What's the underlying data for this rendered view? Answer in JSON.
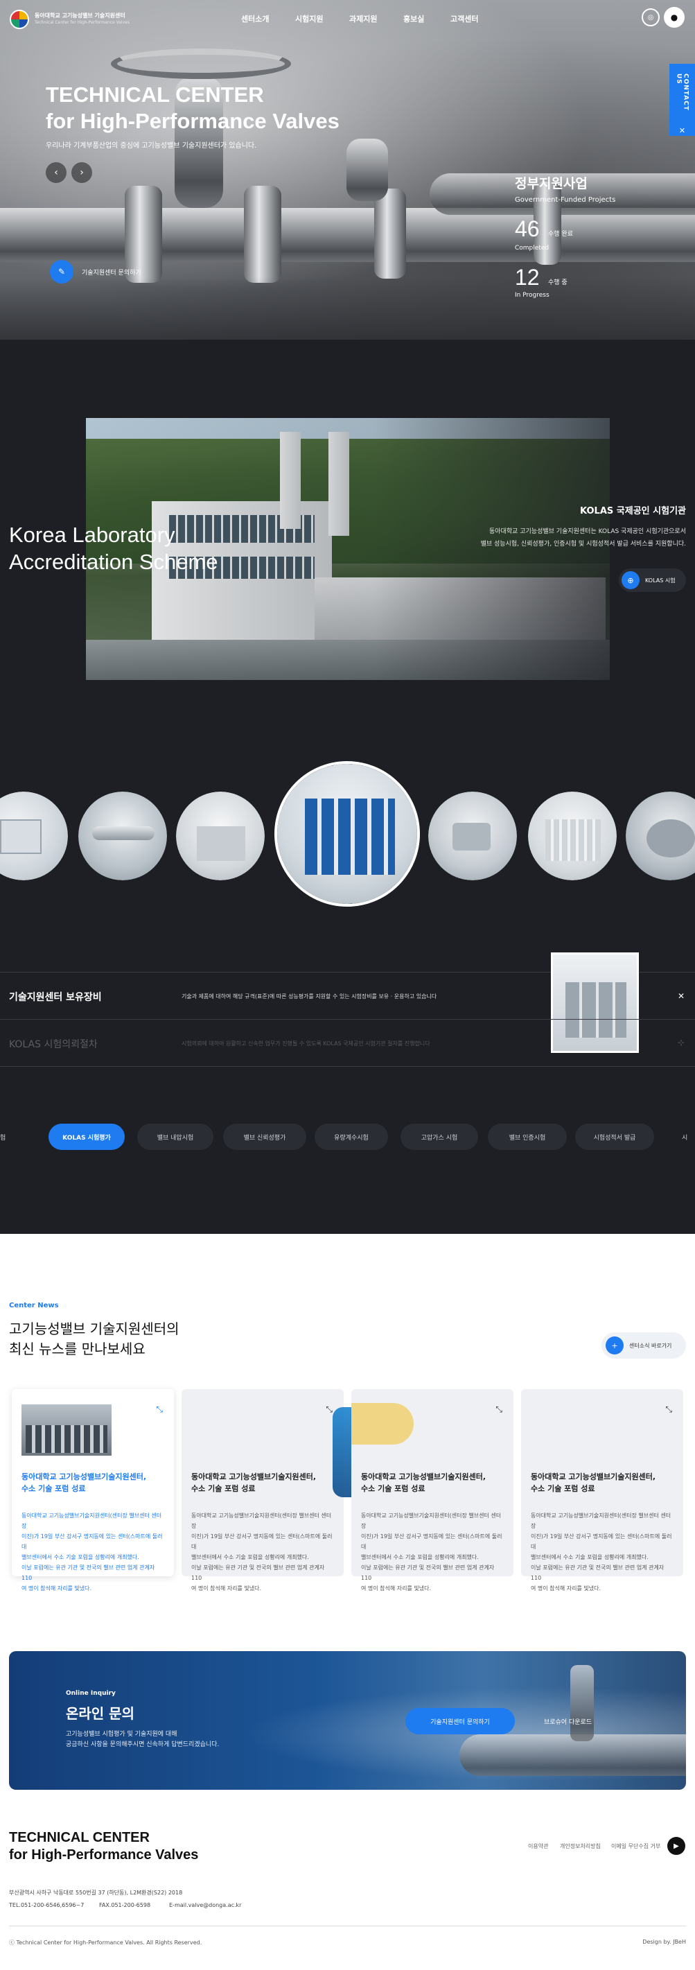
{
  "header": {
    "logo_line1": "동아대학교 고기능성밸브 기술지원센터",
    "logo_line2": "Technical Center for High-Performance Valves",
    "nav": [
      "센터소개",
      "시험지원",
      "과제지원",
      "홍보실",
      "고객센터"
    ],
    "contact_tab": "CONTACT US"
  },
  "hero": {
    "title_line1": "TECHNICAL CENTER",
    "title_line2": "for High-Performance Valves",
    "subtitle": "우리나라 기계부품산업의 중심에 고기능성밸브 기술지원센터가 있습니다.",
    "cta_label": "기술지원센터 문의하기",
    "gov_title": "정부지원사업",
    "gov_sub": "Government-Funded Projects",
    "completed_num": "46",
    "completed_unit": "수행 완료",
    "completed_en": "Completed",
    "progress_num": "12",
    "progress_unit": "수행 중",
    "progress_en": "In Progress"
  },
  "kolas": {
    "title_line1": "Korea Laboratory",
    "title_line2": "Accreditation Scheme",
    "heading": "KOLAS 국제공인 시험기관",
    "desc_line1": "동아대학교 고기능성밸브 기술지원센터는 KOLAS 국제공인 시험기관으로서",
    "desc_line2": "밸브 성능시험, 신뢰성평가, 인증시험 및 시험성적서 발급 서비스를 지원합니다.",
    "button": "KOLAS 시험"
  },
  "equipment": {
    "row1_title": "기술지원센터 보유장비",
    "row1_desc": "기술과 제품에 대하여 해당 규격(표준)에 따른 성능평가를 지원할 수 있는 시험장비를 보유 · 운용하고 있습니다",
    "row2_title": "KOLAS 시험의뢰절차",
    "row2_desc": "시험의뢰에 대하여 원활하고 신속한 업무가 진행될 수 있도록 KOLAS 국제공인 시험기관 절차를 진행합니다"
  },
  "pills": [
    "시험",
    "KOLAS 시험평가",
    "밸브 내압시험",
    "밸브 신뢰성평가",
    "유량계수시험",
    "고압가스 시험",
    "밸브 인증시험",
    "시험성적서 발급",
    "시"
  ],
  "news": {
    "eyebrow": "Center News",
    "title_line1": "고기능성밸브 기술지원센터의",
    "title_line2": "최신 뉴스를 만나보세요",
    "more_label": "센터소식 바로가기",
    "card_title1": "동아대학교 고기능성밸브기술지원센터,",
    "card_title2": "수소 기술 포럼 성료",
    "card_body": [
      "동아대학교 고기능성밸브기술지원센터(센터장 밸브센터 센터장",
      "이진)가 19일 부산 강서구 명지동에 있는 센터(스마트에 둘러대",
      "밸브센터에서 수소 기술 포럼을 성황리에 개최했다.",
      "이날 포럼에는 유관 기관 및 전국의 밸브 관련 업계 관계자 110",
      "여 명이 참석해 자리를 빛냈다."
    ]
  },
  "inquiry": {
    "eyebrow": "Online Inquiry",
    "title": "온라인 문의",
    "desc_line1": "고기능성밸브 시험평가 및 기술지원에 대해",
    "desc_line2": "궁금하신 사항을 문의해주시면 신속하게 답변드리겠습니다.",
    "btn_primary": "기술지원센터 문의하기",
    "btn_secondary": "브로슈어 다운로드"
  },
  "footer": {
    "title_line1": "TECHNICAL CENTER",
    "title_line2": "for High-Performance Valves",
    "links": [
      "이용약관",
      "개인정보처리방침",
      "이메일 무단수집 거부"
    ],
    "address": "부산광역시 사하구 낙동대로 550번길 37 (하단동), L2M환경(S22) 2018",
    "tel": "TEL.051-200-6546,6596~7",
    "fax": "FAX.051-200-6598",
    "email": "E-mail.valve@donga.ac.kr",
    "copyright": "ⓒ Technical Center for High-Performance Valves. All Rights Reserved.",
    "design": "Design by. JBeH"
  },
  "colors": {
    "accent": "#1e7bf0",
    "dark": "#1d1f24",
    "muted": "#666666"
  }
}
